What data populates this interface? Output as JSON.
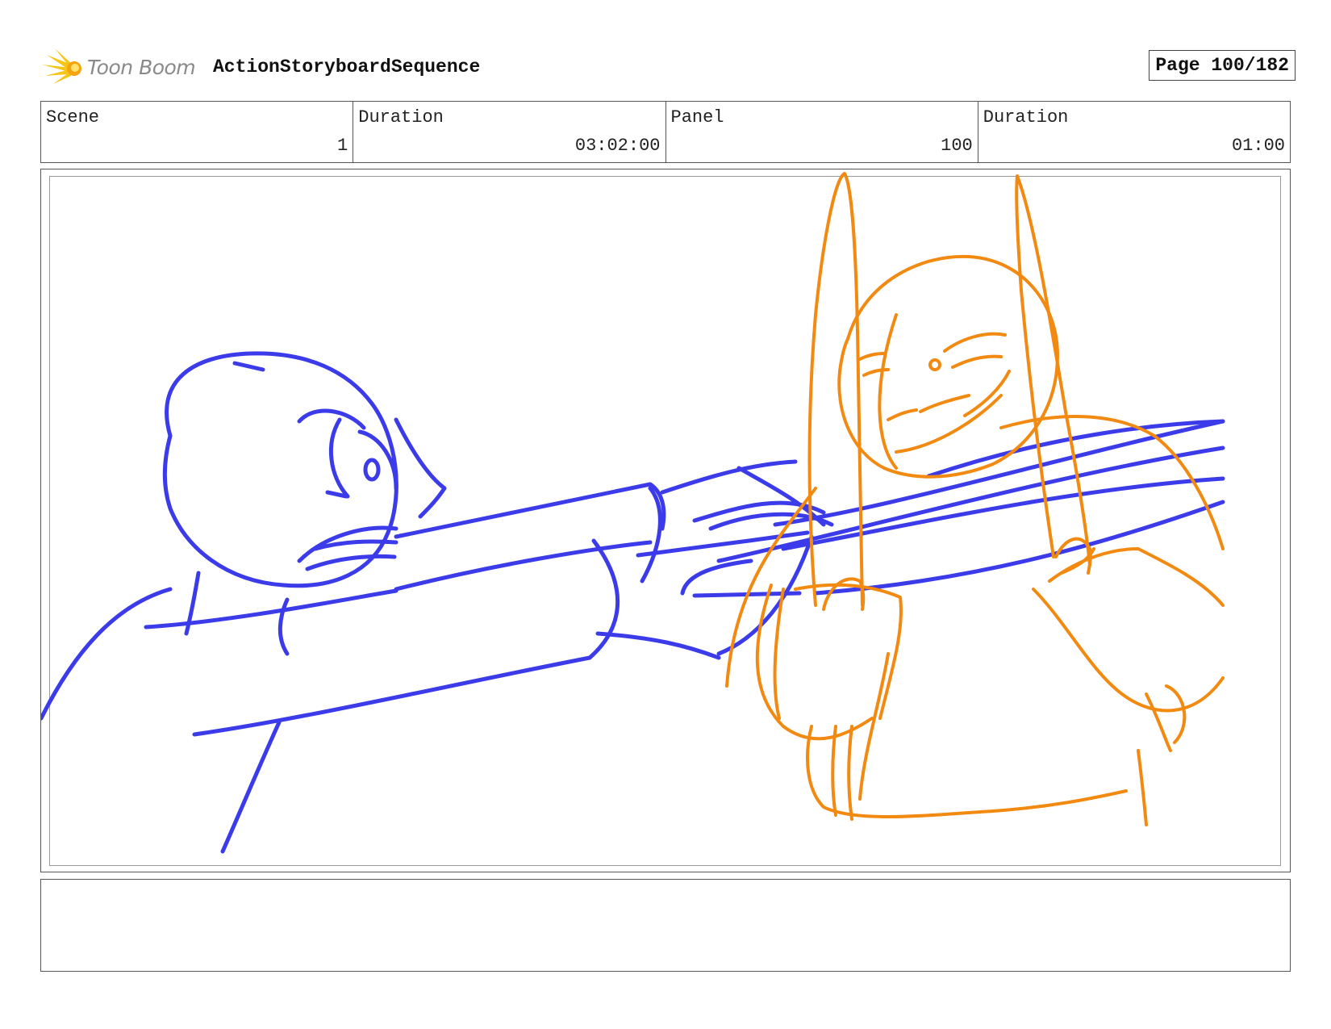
{
  "header": {
    "logo_text": "Toon Boom",
    "sequence_title": "ActionStoryboardSequence",
    "page_label": "Page 100/182"
  },
  "info": [
    {
      "label": "Scene",
      "value": "1"
    },
    {
      "label": "Duration",
      "value": "03:02:00"
    },
    {
      "label": "Panel",
      "value": "100"
    },
    {
      "label": "Duration",
      "value": "01:00"
    }
  ],
  "colors": {
    "blue_character": "#3b3bea",
    "orange_character": "#f28a12",
    "logo_star": "#f5c518"
  },
  "notes": {
    "text": ""
  }
}
